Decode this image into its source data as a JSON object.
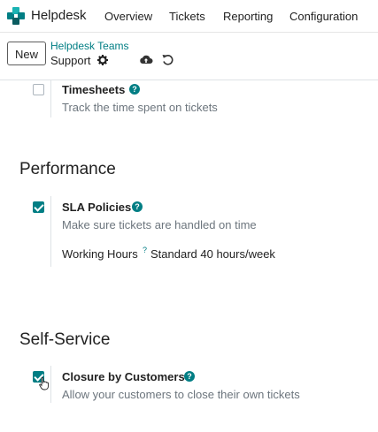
{
  "navbar": {
    "app_name": "Helpdesk",
    "menu": [
      "Overview",
      "Tickets",
      "Reporting",
      "Configuration"
    ]
  },
  "control": {
    "new_label": "New",
    "breadcrumb": "Helpdesk Teams",
    "record_name": "Support"
  },
  "settings": {
    "timesheets": {
      "title": "Timesheets",
      "description": "Track the time spent on tickets",
      "checked": false
    },
    "performance": {
      "section_title": "Performance",
      "sla": {
        "title": "SLA Policies",
        "description": "Make sure tickets are handled on time",
        "checked": true
      },
      "working_hours": {
        "label": "Working Hours",
        "help": "?",
        "value": "Standard 40 hours/week"
      }
    },
    "self_service": {
      "section_title": "Self-Service",
      "closure": {
        "title": "Closure by Customers",
        "description": "Allow your customers to close their own tickets",
        "checked": true
      }
    }
  },
  "colors": {
    "accent": "#017e84",
    "muted_text": "#6c757d"
  },
  "icons": [
    "helpdesk-logo-icon",
    "gear-icon",
    "cloud-upload-icon",
    "undo-icon",
    "help-icon",
    "hand-pointer-icon"
  ]
}
